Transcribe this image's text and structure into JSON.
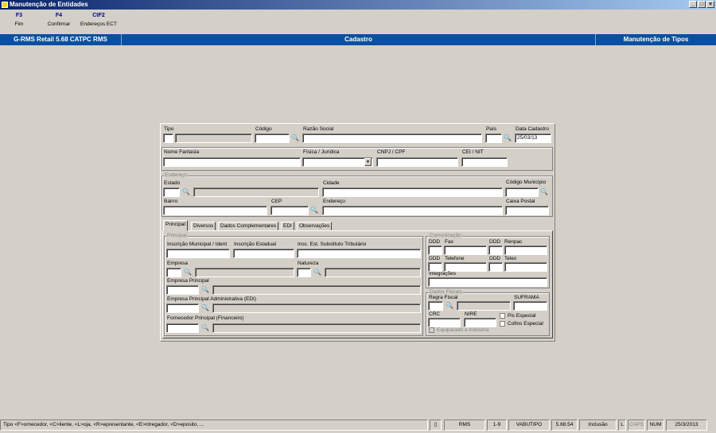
{
  "window": {
    "title": "Manutenção de Entidades"
  },
  "fkeys": [
    {
      "key": "F3",
      "label": "Fim"
    },
    {
      "key": "F4",
      "label": "Confirmar"
    },
    {
      "key": "CtF2",
      "label": "Endereços ECT"
    }
  ],
  "header": {
    "app": "G-RMS Retail 5.68 CATPC RMS",
    "section": "Cadastro",
    "context": "Manutenção de Tipos"
  },
  "form": {
    "tipo_label": "Tipo",
    "codigo_label": "Código",
    "razao_label": "Razão Social",
    "pais_label": "País",
    "data_label": "Data Cadastro",
    "data_value": "25/03/13",
    "fantasia_label": "Nome Fantasia",
    "fisica_label": "Física / Jurídica",
    "cnpj_label": "CNPJ / CPF",
    "cei_label": "CEI / NIT",
    "endereco_group": "Endereço",
    "estado_label": "Estado",
    "cidade_label": "Cidade",
    "codmun_label": "Código Município",
    "bairro_label": "Bairro",
    "cep_label": "CEP",
    "endereco_label": "Endereço",
    "caixa_label": "Caixa Postal"
  },
  "tabs": [
    "Principal",
    "Diversos",
    "Dados Complementares",
    "EDI",
    "Observações"
  ],
  "principal": {
    "group": "Principal",
    "insc_mun": "Inscrição Municipal / Ident",
    "insc_est": "Inscrição Estadual",
    "insc_sub": "Insc. Est. Substituto Tributário",
    "empresa": "Empresa",
    "natureza": "Natureza",
    "empresa_principal": "Empresa Principal",
    "empresa_adm": "Empresa Principal Administrativa (EDI)",
    "fornecedor": "Fornecedor Principal (Financeiro)"
  },
  "comunicacao": {
    "group": "Comunicação",
    "ddd1": "DDD",
    "fax": "Fax",
    "ddd2": "DDD",
    "renpac": "Renpac",
    "ddd3": "DDD",
    "telefone": "Telefone",
    "ddd4": "DDD",
    "telex": "Telex",
    "integracoes": "Integrações"
  },
  "fiscais": {
    "group": "Dados Fiscais",
    "regra": "Regra Fiscal",
    "suframa": "SUFRAMA",
    "crc": "CRC",
    "nire": "NIRE",
    "pis": "Pis Especial",
    "cofins": "Cofins Especial",
    "equiparado": "Equiparado a Indústria"
  },
  "status": {
    "hint": "Tipo <F>ornecedor, <C>liente, <L>oja, <R>epresentante, <E>ntregador, <D>eposito, ...",
    "rms": "RMS",
    "page": "1-9",
    "prog": "VABUTIPO",
    "ver": "5.68.54",
    "mode": "Inclusão",
    "l": "L",
    "caps": "CAPS",
    "num": "NUM",
    "date": "25/3/2013"
  }
}
